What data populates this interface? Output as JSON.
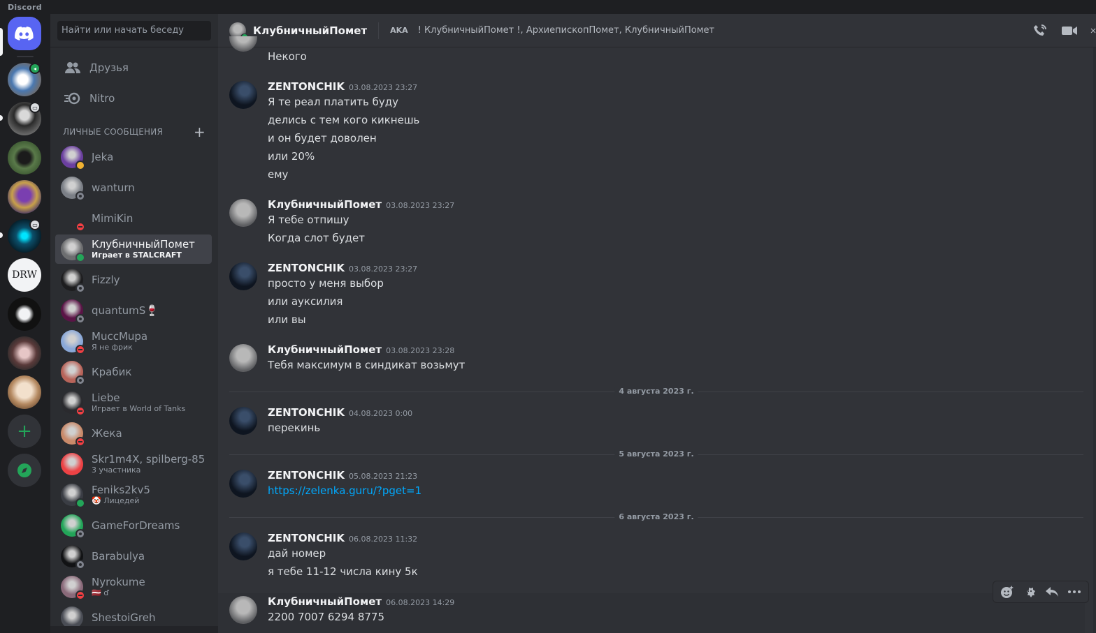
{
  "app": {
    "title": "Discord"
  },
  "search": {
    "placeholder": "Найти или начать беседу"
  },
  "nav": {
    "friends": "Друзья",
    "nitro": "Nitro"
  },
  "dm_section": {
    "title": "ЛИЧНЫЕ СООБЩЕНИЯ",
    "add": "+"
  },
  "dms": [
    {
      "name": "Jeka",
      "sub": "",
      "status": "idle",
      "color": "#6b3fa0"
    },
    {
      "name": "wanturn",
      "sub": "",
      "status": "offline",
      "color": "#7b7f86"
    },
    {
      "name": "MimiKin",
      "sub": "",
      "status": "dnd",
      "color": "#2b2d31"
    },
    {
      "name": "КлубничныйПомет",
      "sub": "Играет в STALCRAFT",
      "status": "online",
      "color": "#6d6e70"
    },
    {
      "name": "Fizzly",
      "sub": "",
      "status": "offline",
      "color": "#1d1d1f"
    },
    {
      "name": "quantumS🍷",
      "sub": "",
      "status": "offline",
      "color": "#5a1446"
    },
    {
      "name": "MuccMupa",
      "sub": "Я не фрик",
      "status": "dnd",
      "color": "#8aa8d8"
    },
    {
      "name": "Крабик",
      "sub": "",
      "status": "offline",
      "color": "#b8645a"
    },
    {
      "name": "Liebe",
      "sub": "Играет в World of Tanks",
      "status": "dnd",
      "color": "#2a2a2e"
    },
    {
      "name": "Жека",
      "sub": "",
      "status": "dnd",
      "color": "#c98a6a"
    },
    {
      "name": "Skr1m4X, spilberg-85",
      "sub": "3 участника",
      "status": "",
      "color": "#ed4245"
    },
    {
      "name": "Feniks2kv5",
      "sub": "🤡 Лицедей",
      "status": "online",
      "color": "#3a3d44"
    },
    {
      "name": "GameForDreams",
      "sub": "",
      "status": "offline",
      "color": "#23a559"
    },
    {
      "name": "Barabulya",
      "sub": "",
      "status": "offline",
      "color": "#111214"
    },
    {
      "name": "Nyrokume",
      "sub": "🇱🇻 ď",
      "status": "dnd",
      "color": "#8a6a7a"
    },
    {
      "name": "ShestoiGreh",
      "sub": "",
      "status": "",
      "color": "#4a4d55"
    }
  ],
  "chat": {
    "user": "КлубничныйПомет",
    "aka_label": "AKA",
    "aka_names": "! КлубничныйПомет !, АрхиепископПомет, КлубничныйПомет",
    "top_line": "Некого",
    "groups": [
      {
        "author": "ZENTONCHIK",
        "time": "03.08.2023 23:27",
        "lines": [
          "Я те реал платить буду",
          "делись с тем кого кикнешь",
          "и он будет доволен",
          "или 20%",
          "ему"
        ]
      },
      {
        "author": "КлубничныйПомет",
        "time": "03.08.2023 23:27",
        "lines": [
          "Я тебе отпишу",
          "Когда слот будет"
        ]
      },
      {
        "author": "ZENTONCHIK",
        "time": "03.08.2023 23:27",
        "lines": [
          "просто у меня выбор",
          "или ауксилия",
          "или вы"
        ]
      },
      {
        "author": "КлубничныйПомет",
        "time": "03.08.2023 23:28",
        "lines": [
          "Тебя максимум в синдикат возьмут"
        ]
      },
      {
        "author": "ZENTONCHIK",
        "time": "04.08.2023 0:00",
        "lines": [
          "перекинь"
        ]
      },
      {
        "author": "ZENTONCHIK",
        "time": "05.08.2023 21:23",
        "lines": [
          "https://zelenka.guru/?pget=1"
        ]
      },
      {
        "author": "ZENTONCHIK",
        "time": "06.08.2023 11:32",
        "lines": [
          "дай номер",
          "я тебе 11-12 числа кину 5к"
        ]
      },
      {
        "author": "КлубничныйПомет",
        "time": "06.08.2023 14:29",
        "lines": [
          "2200 7007 6294 8775"
        ]
      }
    ],
    "dividers": [
      "4 августа 2023 г.",
      "5 августа 2023 г.",
      "6 августа 2023 г."
    ]
  },
  "colors": {
    "accent": "#5865f2",
    "online": "#23a559",
    "dnd": "#f23f43",
    "link": "#00a8fc"
  }
}
